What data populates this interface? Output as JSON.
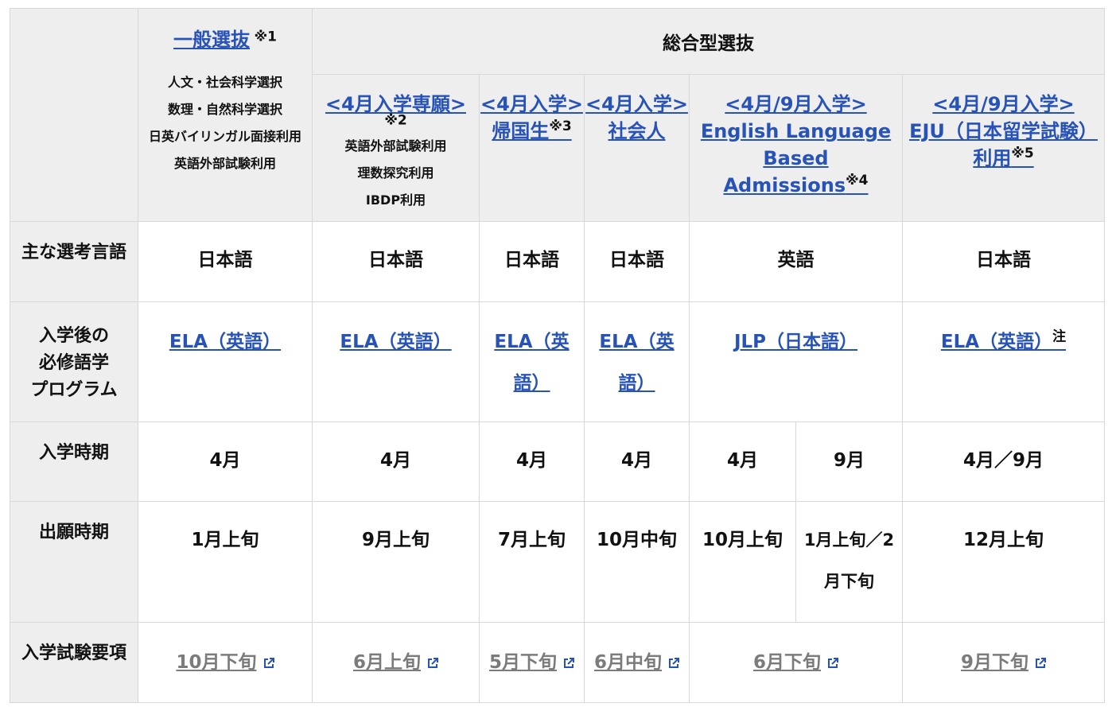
{
  "header": {
    "general": {
      "title": "一般選抜",
      "note": "※1",
      "lines": [
        "人文・社会科学選択",
        "数理・自然科学選択",
        "日英バイリンガル面接利用",
        "英語外部試験利用"
      ]
    },
    "comprehensive": {
      "title": "総合型選抜"
    },
    "april_dedicated": {
      "title": "<4月入学専願>",
      "note": "※2",
      "lines": [
        "英語外部試験利用",
        "理数探究利用",
        "IBDP利用"
      ]
    },
    "april_returnee": {
      "line1": "<4月入学>",
      "line2": "帰国生",
      "note": "※3"
    },
    "april_adult": {
      "line1": "<4月入学>",
      "line2": "社会人"
    },
    "ela_based": {
      "line1": "<4月/9月入学>",
      "line2": "English Language",
      "line3": "Based Admissions",
      "note": "※4"
    },
    "eju": {
      "line1": "<4月/9月入学>",
      "line2": "EJU（日本留学試験）",
      "line3": "利用",
      "note": "※5"
    }
  },
  "rows": {
    "language": {
      "label": "主な選考言語",
      "values": [
        "日本語",
        "日本語",
        "日本語",
        "日本語",
        "英語",
        "日本語"
      ]
    },
    "program": {
      "label_lines": [
        "入学後の",
        "必修語学",
        "プログラム"
      ],
      "values": [
        "ELA（英語）",
        "ELA（英語）",
        "ELA（英語）",
        "ELA（英語）",
        "JLP（日本語）",
        "ELA（英語）"
      ],
      "last_note": "注"
    },
    "entry": {
      "label": "入学時期",
      "values": [
        "4月",
        "4月",
        "4月",
        "4月",
        "4月",
        "9月",
        "4月／9月"
      ]
    },
    "apply": {
      "label": "出願時期",
      "values": [
        "1月上旬",
        "9月上旬",
        "7月上旬",
        "10月中旬",
        "10月上旬",
        "1月上旬／2月下旬",
        "12月上旬"
      ]
    },
    "guide": {
      "label": "入学試験要項",
      "values": [
        "10月下旬",
        "6月上旬",
        "5月下旬",
        "6月中旬",
        "6月下旬",
        "9月下旬"
      ]
    }
  },
  "colors": {
    "link": "#2753b8",
    "gray_link": "#7b7b7b",
    "header_bg": "#eeeeee",
    "border": "#d8d8d8"
  },
  "icons": {
    "external": "external-link-icon"
  }
}
